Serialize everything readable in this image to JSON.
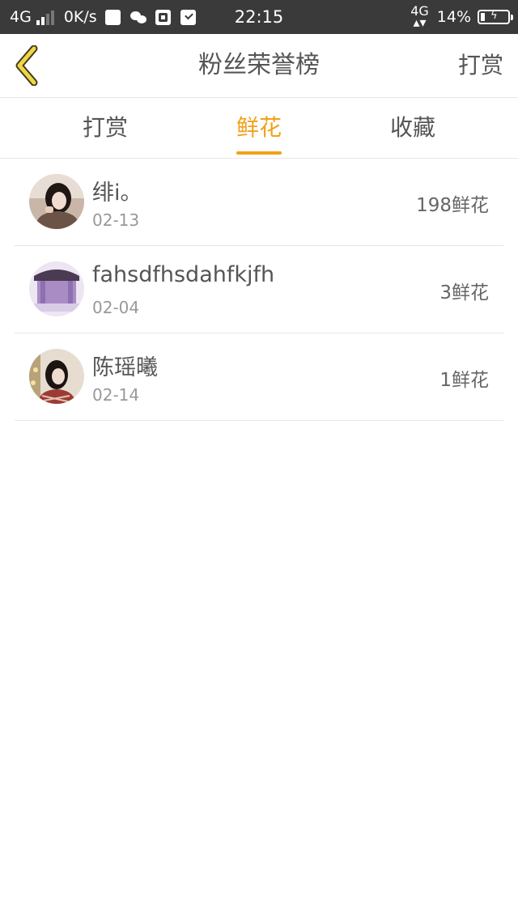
{
  "statusbar": {
    "network": "4G",
    "speed": "0K/s",
    "time": "22:15",
    "network_right": "4G",
    "battery_pct": "14%"
  },
  "header": {
    "title": "粉丝荣誉榜",
    "action": "打赏"
  },
  "tabs": [
    {
      "label": "打赏",
      "active": false
    },
    {
      "label": "鲜花",
      "active": true
    },
    {
      "label": "收藏",
      "active": false
    }
  ],
  "rows": [
    {
      "name": "绯i。",
      "date": "02-13",
      "amount": "198鲜花"
    },
    {
      "name": "fahsdfhsdahfkjfh",
      "date": "02-04",
      "amount": "3鲜花"
    },
    {
      "name": "陈瑶曦",
      "date": "02-14",
      "amount": "1鲜花"
    }
  ],
  "colors": {
    "accent": "#f0a21a",
    "status_bar": "#3a3a3a",
    "text": "#555555",
    "muted": "#999999",
    "divider": "#e6e6e6"
  }
}
